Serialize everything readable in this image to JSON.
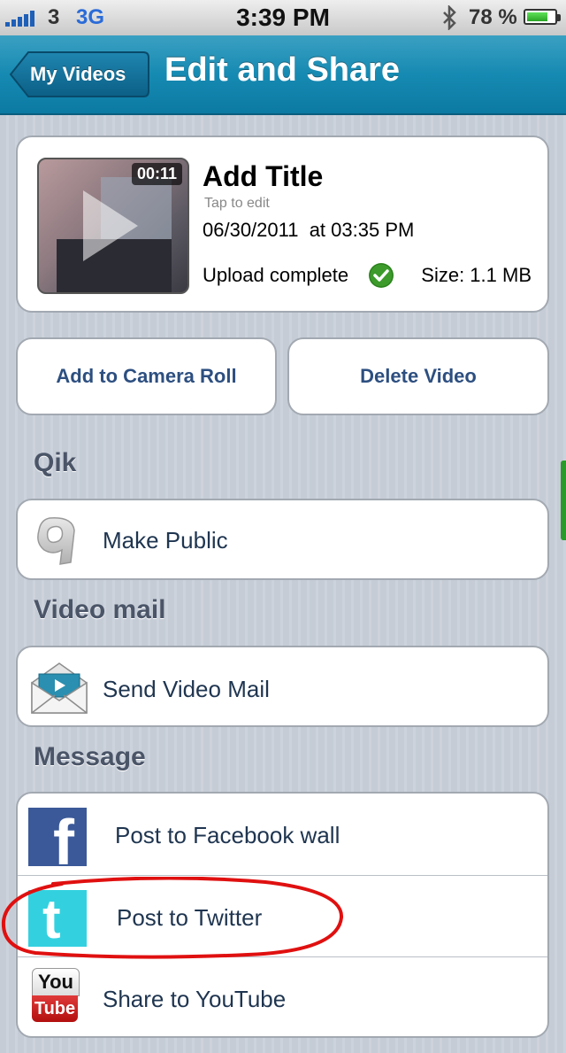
{
  "status_bar": {
    "carrier": "3",
    "network": "3G",
    "time": "3:39 PM",
    "battery_percent": "78 %",
    "battery_level": 0.78
  },
  "nav": {
    "back_label": "My Videos",
    "title": "Edit and Share"
  },
  "video": {
    "duration": "00:11",
    "title": "Add Title",
    "title_hint": "Tap to edit",
    "date": "06/30/2011  at 03:35 PM",
    "upload_status": "Upload complete",
    "size": "Size: 1.1 MB"
  },
  "actions": {
    "add_to_camera_roll": "Add to Camera Roll",
    "delete_video": "Delete Video"
  },
  "sections": {
    "qik": {
      "header": "Qik",
      "make_public": "Make Public"
    },
    "video_mail": {
      "header": "Video mail",
      "send_video_mail": "Send Video Mail"
    },
    "message": {
      "header": "Message",
      "items": [
        {
          "label": "Post to Facebook wall",
          "icon": "facebook-icon"
        },
        {
          "label": "Post to Twitter",
          "icon": "twitter-icon"
        },
        {
          "label": "Share to YouTube",
          "icon": "youtube-icon"
        }
      ]
    }
  },
  "icons": {
    "facebook_glyph": "f",
    "twitter_glyph": "t",
    "youtube_top": "You",
    "youtube_bottom": "Tube"
  },
  "colors": {
    "nav_bar": "#168ab2",
    "button_text": "#2d4f80",
    "facebook": "#3b5998",
    "twitter": "#33d1e0",
    "annotation": "#e01010"
  }
}
